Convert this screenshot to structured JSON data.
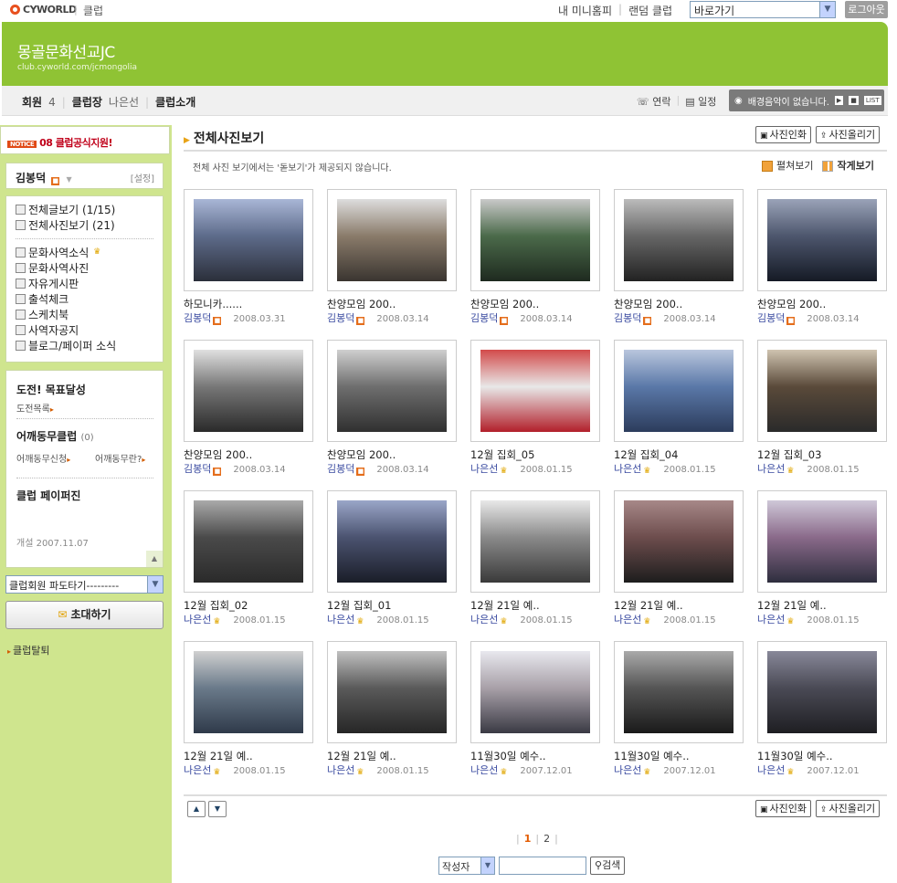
{
  "topbar": {
    "logo": "CYWORLD",
    "club": "클럽",
    "links": [
      "내 미니홈피",
      "랜덤 클럽"
    ],
    "goto": "바로가기",
    "logout": "로그아웃"
  },
  "banner": {
    "title": "몽골문화선교JC",
    "url": "club.cyworld.com/jcmongolia"
  },
  "nav": {
    "member_label": "회원",
    "member_count": "4",
    "owner_label": "클럽장",
    "owner_name": "나은선",
    "intro": "클럽소개",
    "contact": "연락",
    "schedule": "일정",
    "bgm": "배경음악이 없습니다."
  },
  "sidebar": {
    "notice": "08 클럽공식지원!",
    "notice_tag": "NOTICE",
    "user": "김봉덕",
    "settings": "[설정]",
    "menu_top": [
      "전체글보기 (1/15)",
      "전체사진보기 (21)"
    ],
    "menu": [
      "문화사역소식",
      "문화사역사진",
      "자유게시판",
      "출석체크",
      "스케치북",
      "사역자공지",
      "블로그/페이퍼 소식"
    ],
    "challenge_title": "도전! 목표달성",
    "challenge_link": "도전목록",
    "friend_title": "어깨동무클럽",
    "friend_count": "(0)",
    "friend_apply": "어깨동무신청",
    "friend_what": "어깨동무란?",
    "paper_title": "클럽 페이퍼진",
    "opened": "개설  2007.11.07",
    "fan_select": "클럽회원 파도타기---------",
    "invite": "초대하기",
    "leave": "클럽탈퇴"
  },
  "main": {
    "title": "전체사진보기",
    "print_btn": "사진인화",
    "upload_btn": "사진올리기",
    "info": "전체 사진 보기에서는 '돋보기'가 제공되지 않습니다.",
    "view_wide": "펼쳐보기",
    "view_small": "작게보기",
    "pages": [
      "1",
      "2"
    ],
    "search_select": "작성자",
    "search_btn": "검색"
  },
  "photos": [
    {
      "title": "하모니카......",
      "author": "김봉덕",
      "mark": "o",
      "date": "2008.03.31"
    },
    {
      "title": "찬양모임 200..",
      "author": "김봉덕",
      "mark": "o",
      "date": "2008.03.14"
    },
    {
      "title": "찬양모임 200..",
      "author": "김봉덕",
      "mark": "o",
      "date": "2008.03.14"
    },
    {
      "title": "찬양모임 200..",
      "author": "김봉덕",
      "mark": "o",
      "date": "2008.03.14"
    },
    {
      "title": "찬양모임 200..",
      "author": "김봉덕",
      "mark": "o",
      "date": "2008.03.14"
    },
    {
      "title": "찬양모임 200..",
      "author": "김봉덕",
      "mark": "o",
      "date": "2008.03.14"
    },
    {
      "title": "찬양모임 200..",
      "author": "김봉덕",
      "mark": "o",
      "date": "2008.03.14"
    },
    {
      "title": "12월 집회_05",
      "author": "나은선",
      "mark": "c",
      "date": "2008.01.15"
    },
    {
      "title": "12월 집회_04",
      "author": "나은선",
      "mark": "c",
      "date": "2008.01.15"
    },
    {
      "title": "12월 집회_03",
      "author": "나은선",
      "mark": "c",
      "date": "2008.01.15"
    },
    {
      "title": "12월 집회_02",
      "author": "나은선",
      "mark": "c",
      "date": "2008.01.15"
    },
    {
      "title": "12월 집회_01",
      "author": "나은선",
      "mark": "c",
      "date": "2008.01.15"
    },
    {
      "title": "12월 21일 예..",
      "author": "나은선",
      "mark": "c",
      "date": "2008.01.15"
    },
    {
      "title": "12월 21일 예..",
      "author": "나은선",
      "mark": "c",
      "date": "2008.01.15"
    },
    {
      "title": "12월 21일 예..",
      "author": "나은선",
      "mark": "c",
      "date": "2008.01.15"
    },
    {
      "title": "12월 21일 예..",
      "author": "나은선",
      "mark": "c",
      "date": "2008.01.15"
    },
    {
      "title": "12월 21일 예..",
      "author": "나은선",
      "mark": "c",
      "date": "2008.01.15"
    },
    {
      "title": "11월30일 예수..",
      "author": "나은선",
      "mark": "c",
      "date": "2007.12.01"
    },
    {
      "title": "11월30일 예수..",
      "author": "나은선",
      "mark": "c",
      "date": "2007.12.01"
    },
    {
      "title": "11월30일 예수..",
      "author": "나은선",
      "mark": "c",
      "date": "2007.12.01"
    }
  ]
}
